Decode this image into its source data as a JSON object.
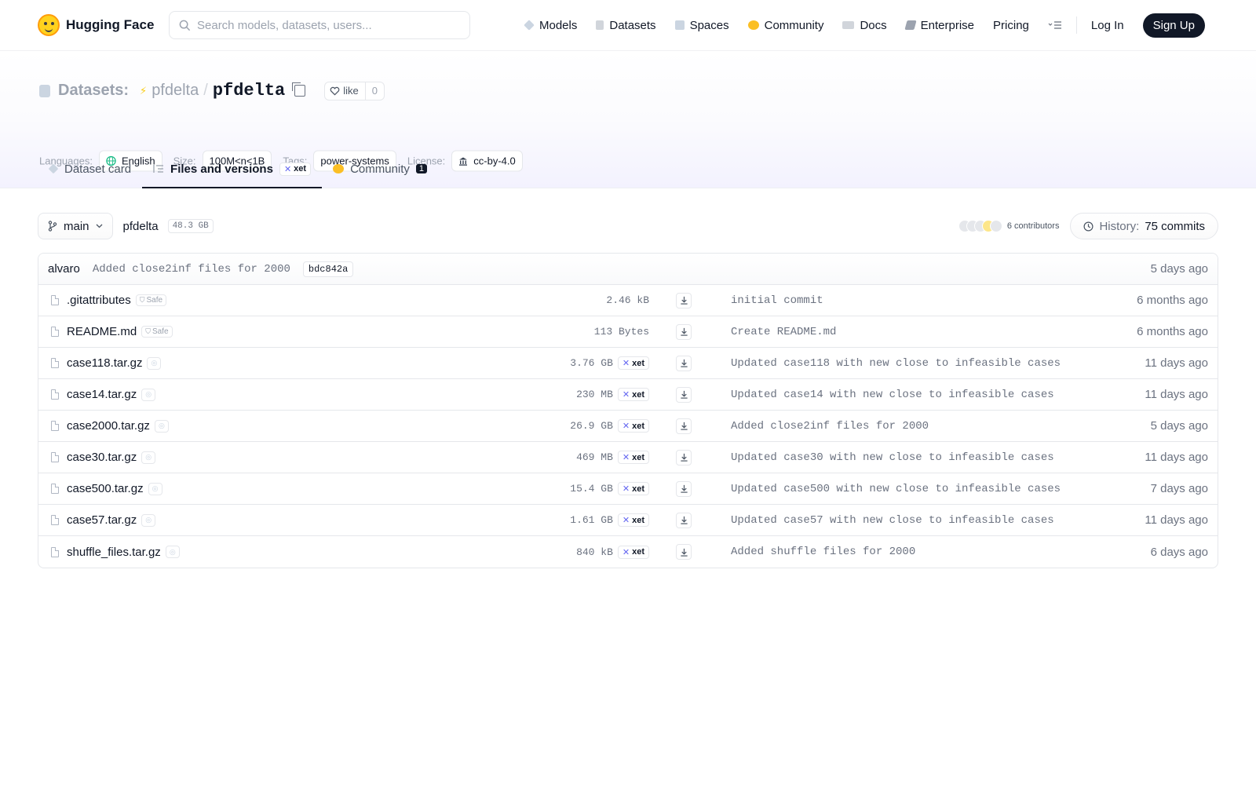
{
  "brand": {
    "name": "Hugging Face"
  },
  "search": {
    "placeholder": "Search models, datasets, users..."
  },
  "nav": {
    "links": [
      "Models",
      "Datasets",
      "Spaces",
      "Community",
      "Docs",
      "Enterprise",
      "Pricing"
    ],
    "login": "Log In",
    "signup": "Sign Up"
  },
  "repo": {
    "type_label": "Datasets:",
    "owner": "pfdelta",
    "slash": "/",
    "name": "pfdelta",
    "like_label": "like",
    "like_count": "0"
  },
  "meta": {
    "languages_label": "Languages:",
    "language": "English",
    "size_label": "Size:",
    "size": "100M<n<1B",
    "tags_label": "Tags:",
    "tag": "power-systems",
    "license_label": "License:",
    "license": "cc-by-4.0"
  },
  "tabs": {
    "card": "Dataset card",
    "files": "Files and versions",
    "files_badge": "xet",
    "community": "Community",
    "community_count": "1"
  },
  "branch": {
    "name": "main",
    "path": "pfdelta",
    "repo_size": "48.3 GB",
    "contributors": "6 contributors",
    "history_label": "History:",
    "history_count": "75 commits"
  },
  "last_commit": {
    "author": "alvaro",
    "message": "Added close2inf files for 2000",
    "sha": "bdc842a",
    "time": "5 days ago"
  },
  "badges": {
    "safe": "Safe",
    "xet": "xet"
  },
  "files": [
    {
      "name": ".gitattributes",
      "badge": "safe",
      "size": "2.46 kB",
      "commit": "initial commit",
      "time": "6 months ago"
    },
    {
      "name": "README.md",
      "badge": "safe",
      "size": "113 Bytes",
      "commit": "Create README.md",
      "time": "6 months ago"
    },
    {
      "name": "case118.tar.gz",
      "badge": "lfs",
      "size": "3.76 GB",
      "commit": "Updated case118 with new close to infeasible cases",
      "time": "11 days ago"
    },
    {
      "name": "case14.tar.gz",
      "badge": "lfs",
      "size": "230 MB",
      "commit": "Updated case14 with new close to infeasible cases",
      "time": "11 days ago"
    },
    {
      "name": "case2000.tar.gz",
      "badge": "lfs",
      "size": "26.9 GB",
      "commit": "Added close2inf files for 2000",
      "time": "5 days ago"
    },
    {
      "name": "case30.tar.gz",
      "badge": "lfs",
      "size": "469 MB",
      "commit": "Updated case30 with new close to infeasible cases",
      "time": "11 days ago"
    },
    {
      "name": "case500.tar.gz",
      "badge": "lfs",
      "size": "15.4 GB",
      "commit": "Updated case500 with new close to infeasible cases",
      "time": "7 days ago"
    },
    {
      "name": "case57.tar.gz",
      "badge": "lfs",
      "size": "1.61 GB",
      "commit": "Updated case57 with new close to infeasible cases",
      "time": "11 days ago"
    },
    {
      "name": "shuffle_files.tar.gz",
      "badge": "lfs",
      "size": "840 kB",
      "commit": "Added shuffle files for 2000",
      "time": "6 days ago"
    }
  ],
  "colors": {
    "accent_dark": "#111827",
    "muted": "#6b7280",
    "xet": "#6366f1",
    "hf_yellow": "#ffd21e"
  },
  "icons": [
    "hf-logo",
    "search-icon",
    "models-icon",
    "datasets-icon",
    "spaces-icon",
    "community-icon",
    "docs-icon",
    "enterprise-icon",
    "menu-icon",
    "copy-icon",
    "heart-icon",
    "globe-icon",
    "license-icon",
    "branch-icon",
    "history-icon",
    "file-icon",
    "download-icon",
    "xet-icon",
    "shield-icon"
  ]
}
